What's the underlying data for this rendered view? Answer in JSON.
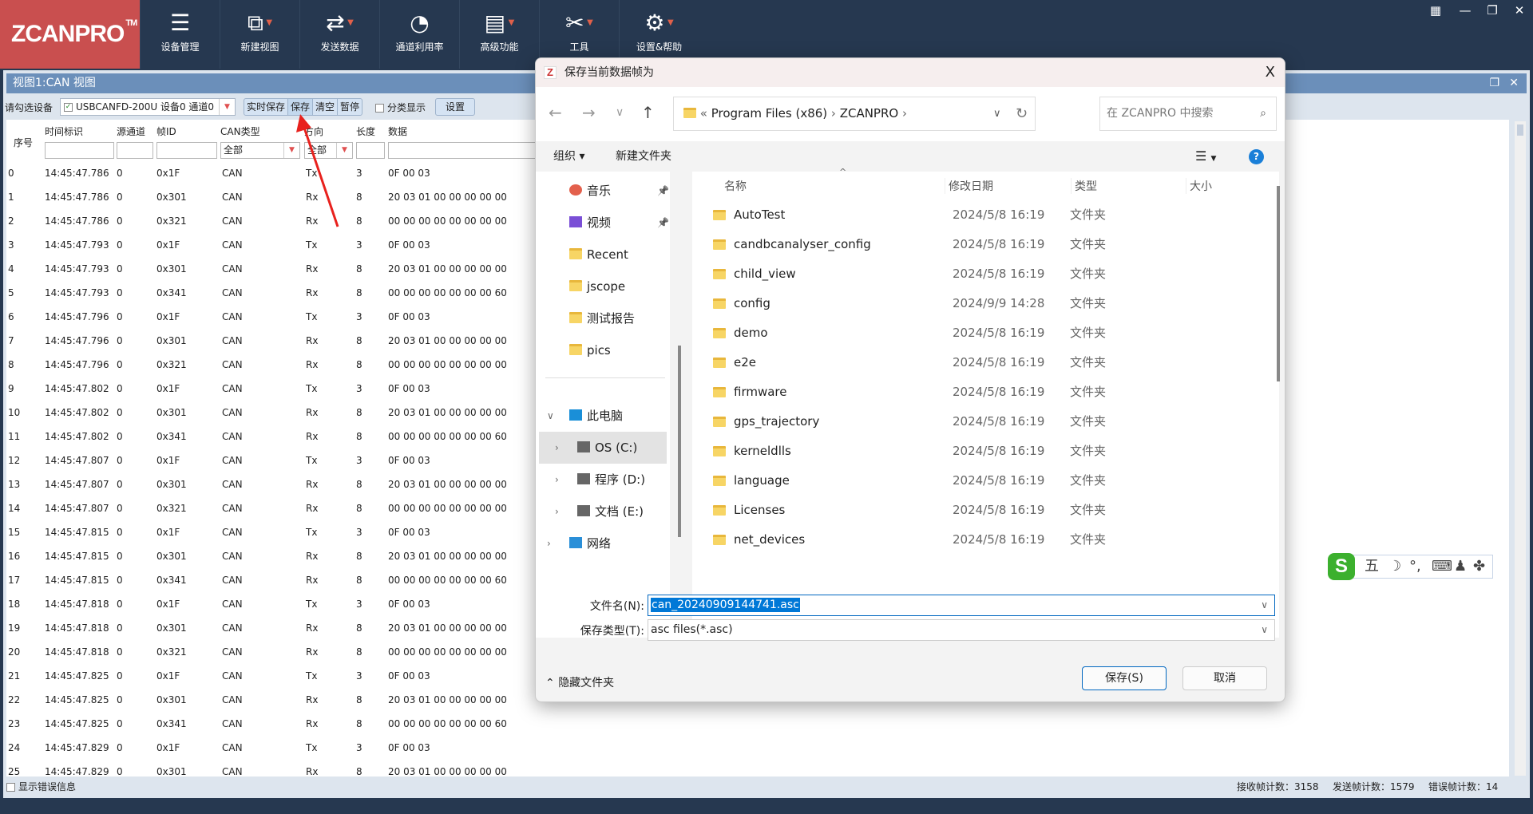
{
  "app": {
    "logo": "ZCANPRO",
    "tm": "TM",
    "toolbar": [
      {
        "label": "设备管理",
        "icon": "device-manage-icon",
        "glyph": "☰",
        "dropdown": false
      },
      {
        "label": "新建视图",
        "icon": "new-view-icon",
        "glyph": "⧉",
        "dropdown": true
      },
      {
        "label": "发送数据",
        "icon": "send-data-icon",
        "glyph": "⇄",
        "dropdown": true
      },
      {
        "label": "通道利用率",
        "icon": "channel-usage-icon",
        "glyph": "◔",
        "dropdown": false
      },
      {
        "label": "高级功能",
        "icon": "advanced-icon",
        "glyph": "▤",
        "dropdown": true
      },
      {
        "label": "工具",
        "icon": "tools-icon",
        "glyph": "✂",
        "dropdown": true
      },
      {
        "label": "设置&帮助",
        "icon": "settings-icon",
        "glyph": "⚙",
        "dropdown": true
      }
    ],
    "dropdown_glyph": "▼"
  },
  "view": {
    "title": "视图1:CAN 视图",
    "select_label": "请勾选设备",
    "device": "USBCANFD-200U 设备0 通道0",
    "buttons": [
      "实时保存",
      "保存",
      "清空",
      "暂停"
    ],
    "classify": "分类显示",
    "settings": "设置",
    "columns": [
      "序号",
      "时间标识",
      "源通道",
      "帧ID",
      "CAN类型",
      "方向",
      "长度",
      "数据"
    ],
    "filters": {
      "can_type": "全部",
      "direction": "全部"
    },
    "rows": [
      [
        "0",
        "14:45:47.786",
        "0",
        "0x1F",
        "CAN",
        "Tx",
        "3",
        "0F 00 03"
      ],
      [
        "1",
        "14:45:47.786",
        "0",
        "0x301",
        "CAN",
        "Rx",
        "8",
        "20 03 01 00 00 00 00 00"
      ],
      [
        "2",
        "14:45:47.786",
        "0",
        "0x321",
        "CAN",
        "Rx",
        "8",
        "00 00 00 00 00 00 00 00"
      ],
      [
        "3",
        "14:45:47.793",
        "0",
        "0x1F",
        "CAN",
        "Tx",
        "3",
        "0F 00 03"
      ],
      [
        "4",
        "14:45:47.793",
        "0",
        "0x301",
        "CAN",
        "Rx",
        "8",
        "20 03 01 00 00 00 00 00"
      ],
      [
        "5",
        "14:45:47.793",
        "0",
        "0x341",
        "CAN",
        "Rx",
        "8",
        "00 00 00 00 00 00 00 60"
      ],
      [
        "6",
        "14:45:47.796",
        "0",
        "0x1F",
        "CAN",
        "Tx",
        "3",
        "0F 00 03"
      ],
      [
        "7",
        "14:45:47.796",
        "0",
        "0x301",
        "CAN",
        "Rx",
        "8",
        "20 03 01 00 00 00 00 00"
      ],
      [
        "8",
        "14:45:47.796",
        "0",
        "0x321",
        "CAN",
        "Rx",
        "8",
        "00 00 00 00 00 00 00 00"
      ],
      [
        "9",
        "14:45:47.802",
        "0",
        "0x1F",
        "CAN",
        "Tx",
        "3",
        "0F 00 03"
      ],
      [
        "10",
        "14:45:47.802",
        "0",
        "0x301",
        "CAN",
        "Rx",
        "8",
        "20 03 01 00 00 00 00 00"
      ],
      [
        "11",
        "14:45:47.802",
        "0",
        "0x341",
        "CAN",
        "Rx",
        "8",
        "00 00 00 00 00 00 00 60"
      ],
      [
        "12",
        "14:45:47.807",
        "0",
        "0x1F",
        "CAN",
        "Tx",
        "3",
        "0F 00 03"
      ],
      [
        "13",
        "14:45:47.807",
        "0",
        "0x301",
        "CAN",
        "Rx",
        "8",
        "20 03 01 00 00 00 00 00"
      ],
      [
        "14",
        "14:45:47.807",
        "0",
        "0x321",
        "CAN",
        "Rx",
        "8",
        "00 00 00 00 00 00 00 00"
      ],
      [
        "15",
        "14:45:47.815",
        "0",
        "0x1F",
        "CAN",
        "Tx",
        "3",
        "0F 00 03"
      ],
      [
        "16",
        "14:45:47.815",
        "0",
        "0x301",
        "CAN",
        "Rx",
        "8",
        "20 03 01 00 00 00 00 00"
      ],
      [
        "17",
        "14:45:47.815",
        "0",
        "0x341",
        "CAN",
        "Rx",
        "8",
        "00 00 00 00 00 00 00 60"
      ],
      [
        "18",
        "14:45:47.818",
        "0",
        "0x1F",
        "CAN",
        "Tx",
        "3",
        "0F 00 03"
      ],
      [
        "19",
        "14:45:47.818",
        "0",
        "0x301",
        "CAN",
        "Rx",
        "8",
        "20 03 01 00 00 00 00 00"
      ],
      [
        "20",
        "14:45:47.818",
        "0",
        "0x321",
        "CAN",
        "Rx",
        "8",
        "00 00 00 00 00 00 00 00"
      ],
      [
        "21",
        "14:45:47.825",
        "0",
        "0x1F",
        "CAN",
        "Tx",
        "3",
        "0F 00 03"
      ],
      [
        "22",
        "14:45:47.825",
        "0",
        "0x301",
        "CAN",
        "Rx",
        "8",
        "20 03 01 00 00 00 00 00"
      ],
      [
        "23",
        "14:45:47.825",
        "0",
        "0x341",
        "CAN",
        "Rx",
        "8",
        "00 00 00 00 00 00 00 60"
      ],
      [
        "24",
        "14:45:47.829",
        "0",
        "0x1F",
        "CAN",
        "Tx",
        "3",
        "0F 00 03"
      ],
      [
        "25",
        "14:45:47.829",
        "0",
        "0x301",
        "CAN",
        "Rx",
        "8",
        "20 03 01 00 00 00 00 00"
      ]
    ],
    "status": {
      "show_errors": "显示错误信息",
      "rx": "接收帧计数：3158",
      "tx": "发送帧计数：1579",
      "err": "错误帧计数：14"
    }
  },
  "dialog": {
    "title": "保存当前数据帧为",
    "close": "X",
    "breadcrumb": [
      "Program Files (x86)",
      "ZCANPRO"
    ],
    "search_placeholder": "在 ZCANPRO 中搜索",
    "organize": "组织 ▾",
    "new_folder": "新建文件夹",
    "nav": [
      {
        "label": "音乐",
        "type": "music",
        "pinned": true
      },
      {
        "label": "视频",
        "type": "video",
        "pinned": true
      },
      {
        "label": "Recent",
        "type": "folder"
      },
      {
        "label": "jscope",
        "type": "folder"
      },
      {
        "label": "测试报告",
        "type": "folder"
      },
      {
        "label": "pics",
        "type": "folder-check"
      }
    ],
    "tree": [
      {
        "label": "此电脑",
        "expanded": true
      },
      {
        "label": "OS (C:)",
        "selected": true
      },
      {
        "label": "程序 (D:)"
      },
      {
        "label": "文档 (E:)"
      },
      {
        "label": "网络"
      }
    ],
    "columns": [
      "名称",
      "修改日期",
      "类型",
      "大小"
    ],
    "files": [
      [
        "AutoTest",
        "2024/5/8 16:19",
        "文件夹"
      ],
      [
        "candbcanalyser_config",
        "2024/5/8 16:19",
        "文件夹"
      ],
      [
        "child_view",
        "2024/5/8 16:19",
        "文件夹"
      ],
      [
        "config",
        "2024/9/9 14:28",
        "文件夹"
      ],
      [
        "demo",
        "2024/5/8 16:19",
        "文件夹"
      ],
      [
        "e2e",
        "2024/5/8 16:19",
        "文件夹"
      ],
      [
        "firmware",
        "2024/5/8 16:19",
        "文件夹"
      ],
      [
        "gps_trajectory",
        "2024/5/8 16:19",
        "文件夹"
      ],
      [
        "kerneldlls",
        "2024/5/8 16:19",
        "文件夹"
      ],
      [
        "language",
        "2024/5/8 16:19",
        "文件夹"
      ],
      [
        "Licenses",
        "2024/5/8 16:19",
        "文件夹"
      ],
      [
        "net_devices",
        "2024/5/8 16:19",
        "文件夹"
      ]
    ],
    "filename_label": "文件名(N):",
    "filename": "can_20240909144741.asc",
    "filetype_label": "保存类型(T):",
    "filetype": "asc files(*.asc)",
    "hide_folders": "隐藏文件夹",
    "save": "保存(S)",
    "cancel": "取消"
  },
  "ime": {
    "mode": "五"
  },
  "colors": {
    "topbar": "#263850",
    "logo_bg": "#c94f4f",
    "view_title": "#6b8fba",
    "accent": "#0078d7",
    "arrow": "#e8211d"
  }
}
